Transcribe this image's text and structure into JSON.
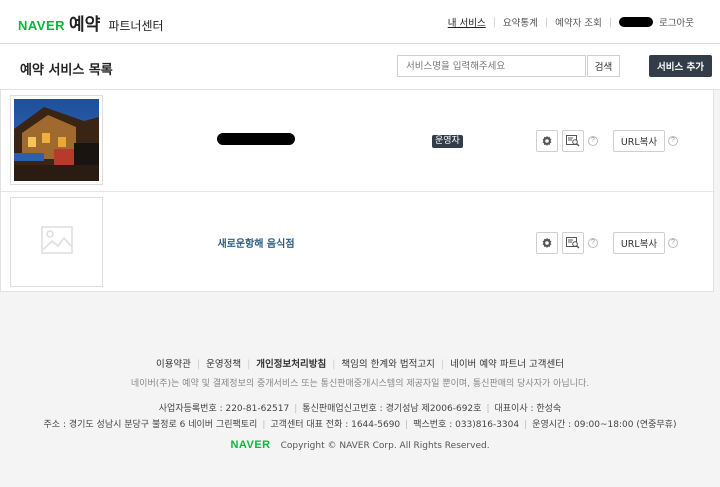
{
  "header": {
    "logo_brand": "NAVER",
    "logo_service": "예약",
    "logo_sub": "파트너센터",
    "nav": {
      "my_services": "내 서비스",
      "summary_stats": "요약통계",
      "booker_lookup": "예약자 조회",
      "logout": "로그아웃"
    }
  },
  "toolbar": {
    "title": "예약 서비스 목록",
    "search_placeholder": "서비스명을 입력해주세요",
    "search_label": "검색",
    "add_label": "서비스 추가"
  },
  "services": [
    {
      "name": "",
      "status": "운영자",
      "url_label": "URL복사",
      "has_photo": true
    },
    {
      "name": "새로운항해 음식점",
      "status": "",
      "url_label": "URL복사",
      "has_photo": false
    }
  ],
  "footer": {
    "links": [
      "이용약관",
      "운영정책",
      "개인정보처리방침",
      "책임의 한계와 법적고지",
      "네이버 예약 파트너 고객센터"
    ],
    "notice": "네이버(주)는 예약 및 결제정보의 중개서비스 또는 통신판매중개시스템의 제공자일 뿐이며, 통신판매의 당사자가 아닙니다.",
    "biz_reg": "사업자등록번호 : 220-81-62517",
    "ecommerce_reg": "통신판매업신고번호 : 경기성남 제2006-692호",
    "ceo": "대표이사 : 한성숙",
    "address": "주소 : 경기도 성남시 분당구 불정로 6 네이버 그린팩토리",
    "phone": "고객센터 대표 전화 : 1644-5690",
    "fax": "팩스번호 : 033)816-3304",
    "hours": "운영시간 : 09:00~18:00 (연중무휴)",
    "copyright_logo": "NAVER",
    "copyright": "Copyright © NAVER Corp. All Rights Reserved."
  },
  "colors": {
    "brand_green": "#03b93a",
    "dark_button": "#333d4a",
    "link_blue": "#2b5f86"
  }
}
